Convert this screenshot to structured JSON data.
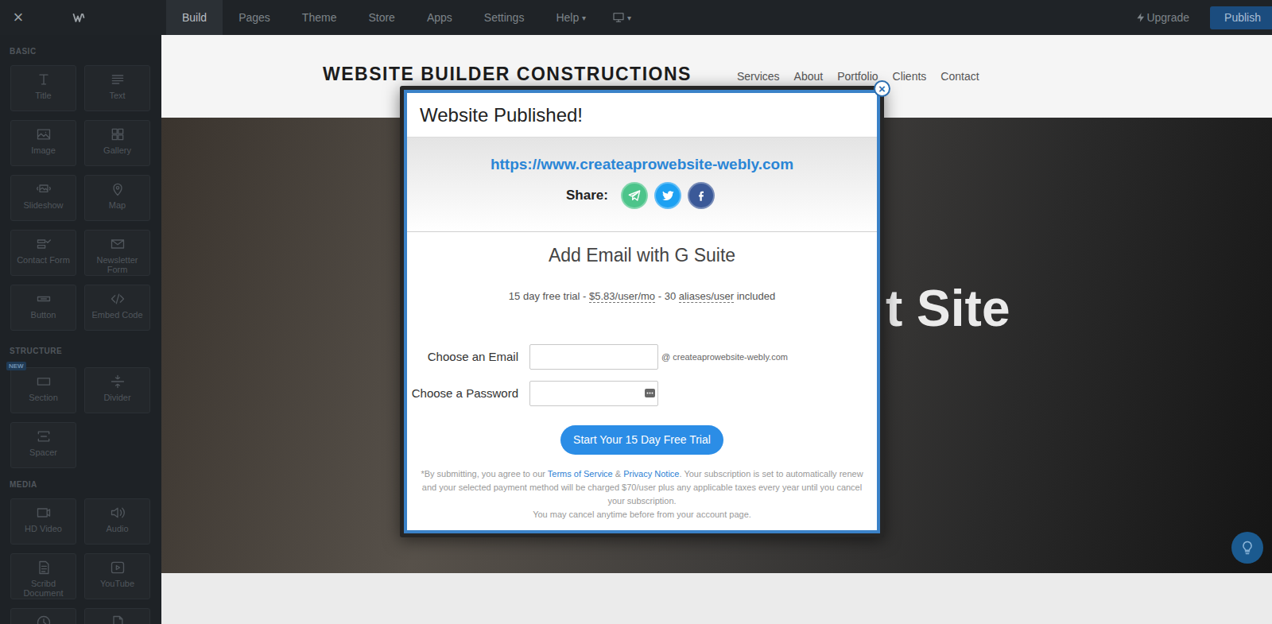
{
  "topbar": {
    "close": "×",
    "nav": [
      {
        "label": "Build",
        "selected": true
      },
      {
        "label": "Pages",
        "selected": false
      },
      {
        "label": "Theme",
        "selected": false
      },
      {
        "label": "Store",
        "selected": false
      },
      {
        "label": "Apps",
        "selected": false
      },
      {
        "label": "Settings",
        "selected": false
      },
      {
        "label": "Help",
        "selected": false,
        "caret": "▾"
      }
    ],
    "device_caret": "▾",
    "upgrade": "Upgrade",
    "publish": "Publish"
  },
  "sidebar": {
    "sections": [
      {
        "title": "BASIC",
        "items": [
          {
            "label": "Title"
          },
          {
            "label": "Text"
          },
          {
            "label": "Image"
          },
          {
            "label": "Gallery"
          },
          {
            "label": "Slideshow"
          },
          {
            "label": "Map"
          },
          {
            "label": "Contact Form"
          },
          {
            "label": "Newsletter Form"
          },
          {
            "label": "Button"
          },
          {
            "label": "Embed Code"
          }
        ]
      },
      {
        "title": "STRUCTURE",
        "badge": "NEW",
        "items": [
          {
            "label": "Section"
          },
          {
            "label": "Divider"
          },
          {
            "label": "Spacer"
          }
        ]
      },
      {
        "title": "MEDIA",
        "items": [
          {
            "label": "HD Video"
          },
          {
            "label": "Audio"
          },
          {
            "label": "Scribd Document"
          },
          {
            "label": "YouTube"
          },
          {},
          {}
        ]
      }
    ]
  },
  "site": {
    "title": "WEBSITE BUILDER CONSTRUCTIONS",
    "nav": [
      "Services",
      "About",
      "Portfolio",
      "Clients",
      "Contact"
    ],
    "hero_title": "t Site"
  },
  "modal": {
    "close": "×",
    "title": "Website Published!",
    "url": "https://www.createaprowebsite-webly.com",
    "share_label": "Share:",
    "share": [
      {
        "color": "#4cc48a"
      },
      {
        "color": "#1da1f2"
      },
      {
        "color": "#3b5998"
      }
    ],
    "offer_title": "Add Email with G Suite",
    "offer_terms": [
      {
        "text": "15 day free trial - ",
        "underlined": false
      },
      {
        "text": "$5.83/user/mo",
        "underlined": true
      },
      {
        "text": " - 30 ",
        "underlined": false
      },
      {
        "text": "aliases/user",
        "underlined": true
      },
      {
        "text": " included",
        "underlined": false
      }
    ],
    "fields": [
      {
        "label": "Choose an Email",
        "value": "",
        "kind": "text",
        "suffix": "@ createaprowebsite-webly.com"
      },
      {
        "label": "Choose a Password",
        "value": "",
        "kind": "password"
      }
    ],
    "submit": "Start Your 15 Day Free Trial",
    "fine_print": [
      {
        "text": "*By submitting, you agree to our ",
        "link": false
      },
      {
        "text": "Terms of Service",
        "link": true
      },
      {
        "text": " & ",
        "link": false
      },
      {
        "text": "Privacy Notice",
        "link": true
      },
      {
        "text": ". Your subscription is set to automatically renew and your selected payment method will be charged $70/user plus any applicable taxes every year until you cancel your subscription.",
        "link": false
      }
    ],
    "cancel_note": "You may cancel anytime before from your account page."
  }
}
